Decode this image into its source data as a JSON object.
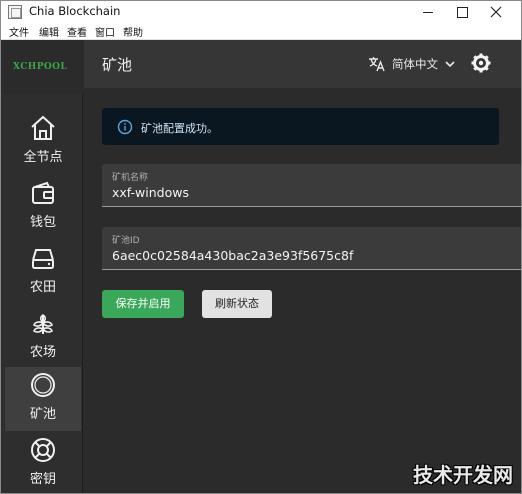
{
  "window": {
    "title": "Chia Blockchain"
  },
  "menu": [
    "文件",
    "编辑",
    "查看",
    "窗口",
    "帮助"
  ],
  "logo": "XCHPOOL",
  "sidebar": {
    "items": [
      {
        "label": "全节点",
        "icon": "home-icon"
      },
      {
        "label": "钱包",
        "icon": "wallet-icon"
      },
      {
        "label": "农田",
        "icon": "hard-drive-icon"
      },
      {
        "label": "农场",
        "icon": "plant-icon"
      },
      {
        "label": "矿池",
        "icon": "pool-circle-icon",
        "active": true
      },
      {
        "label": "密钥",
        "icon": "lifebuoy-icon"
      }
    ]
  },
  "header": {
    "title": "矿池",
    "language": "简体中文"
  },
  "alert": {
    "text": "矿池配置成功。"
  },
  "fields": {
    "miner_name": {
      "label": "矿机名称",
      "value": "xxf-windows"
    },
    "pool_id": {
      "label": "矿池ID",
      "value": "6aec0c02584a430bac2a3e93f5675c8f"
    }
  },
  "buttons": {
    "save": "保存并启用",
    "refresh": "刷新状态"
  },
  "watermark": "技术开发网",
  "colors": {
    "accent_green": "#3aa85a",
    "sidebar_bg": "#2e2e2e",
    "content_bg": "#2b2b2b",
    "alert_bg": "#0a1620"
  }
}
